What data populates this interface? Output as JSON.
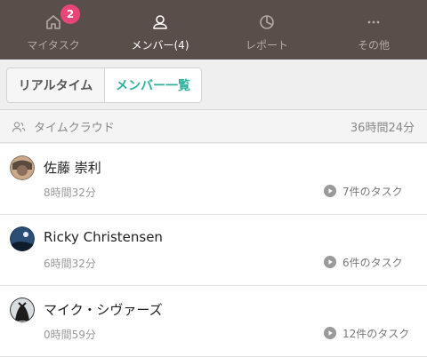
{
  "nav": {
    "items": [
      {
        "label": "マイタスク",
        "icon": "home-icon",
        "badge": "2"
      },
      {
        "label": "メンバー(4)",
        "icon": "person-icon"
      },
      {
        "label": "レポート",
        "icon": "pie-chart-icon"
      },
      {
        "label": "その他",
        "icon": "more-icon"
      }
    ],
    "active_color": "#ffffff",
    "bg_color": "#5a4e4b",
    "badge_color": "#e8457a"
  },
  "segment": {
    "realtime_label": "リアルタイム",
    "members_label": "メンバー一覧",
    "active_color": "#2fb19a"
  },
  "group": {
    "name": "タイムクラウド",
    "total": "36時間24分",
    "icon": "users-icon"
  },
  "members": [
    {
      "name": "佐藤 崇利",
      "time": "8時間32分",
      "tasks": "7件のタスク",
      "avatar": "avatar-photo"
    },
    {
      "name": "Ricky Christensen",
      "time": "6時間32分",
      "tasks": "6件のタスク",
      "avatar": "avatar-photo"
    },
    {
      "name": "マイク・シヴァーズ",
      "time": "0時間59分",
      "tasks": "12件のタスク",
      "avatar": "avatar-photo"
    }
  ]
}
